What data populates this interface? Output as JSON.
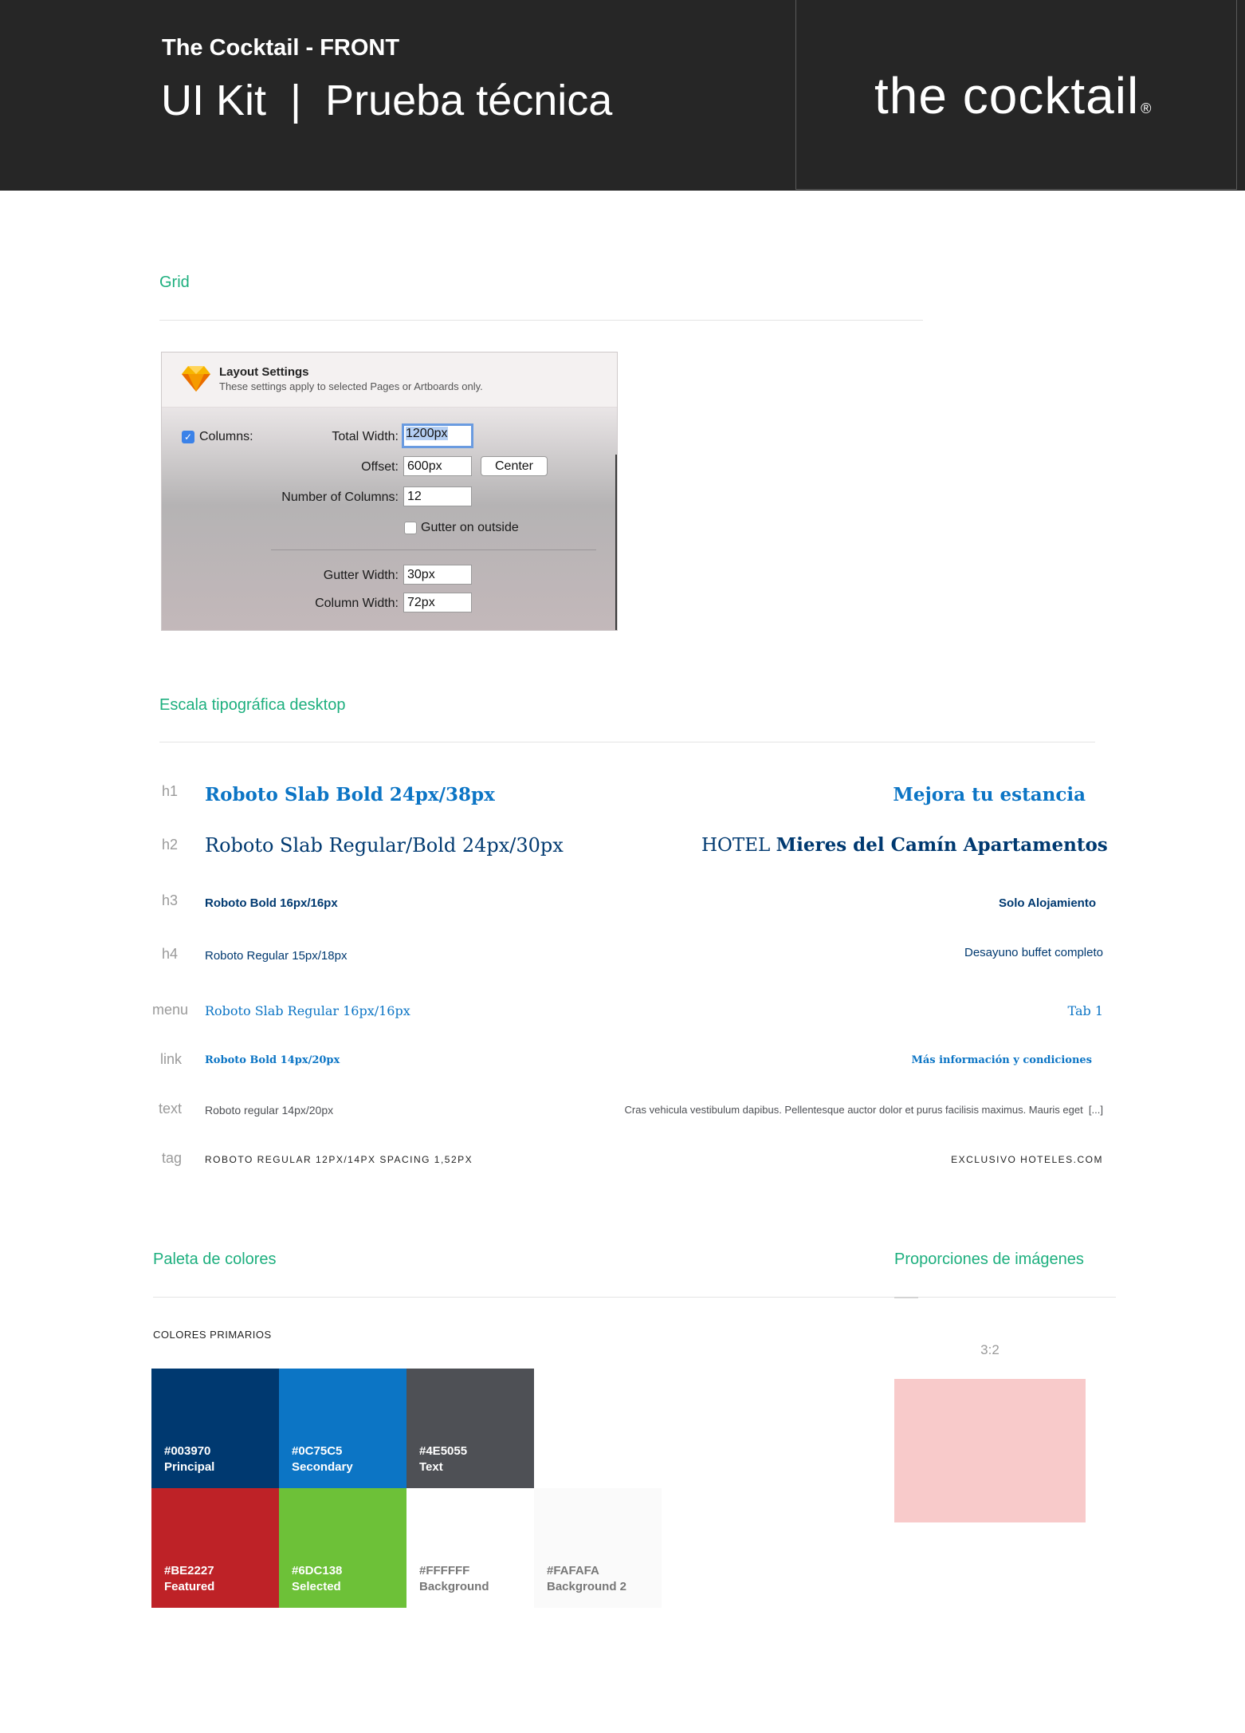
{
  "header": {
    "subtitle": "The Cocktail - FRONT",
    "title": "UI Kit  |  Prueba técnica",
    "logo_text": "the cocktail",
    "logo_mark": "®"
  },
  "grid": {
    "section_title": "Grid",
    "panel": {
      "icon": "sketch-diamond-icon",
      "title": "Layout Settings",
      "subtitle": "These settings apply to selected Pages or Artboards only.",
      "columns_label": "Columns:",
      "columns_checked": true,
      "total_width_label": "Total Width:",
      "total_width_value": "1200px",
      "offset_label": "Offset:",
      "offset_value": "600px",
      "center_button": "Center",
      "number_of_columns_label": "Number of Columns:",
      "number_of_columns_value": "12",
      "gutter_outside_label": "Gutter on outside",
      "gutter_outside_checked": false,
      "gutter_width_label": "Gutter Width:",
      "gutter_width_value": "30px",
      "column_width_label": "Column Width:",
      "column_width_value": "72px"
    }
  },
  "typography": {
    "section_title": "Escala tipográfica desktop",
    "rows": [
      {
        "tag": "h1",
        "spec": "Roboto Slab Bold 24px/38px",
        "sample": "Mejora tu estancia"
      },
      {
        "tag": "h2",
        "spec": "Roboto Slab Regular/Bold 24px/30px",
        "sample_regular": "HOTEL ",
        "sample_bold": "Mieres del Camín Apartamentos"
      },
      {
        "tag": "h3",
        "spec": "Roboto Bold 16px/16px",
        "sample": "Solo Alojamiento"
      },
      {
        "tag": "h4",
        "spec": "Roboto Regular 15px/18px",
        "sample": "Desayuno buffet completo"
      },
      {
        "tag": "menu",
        "spec": "Roboto Slab Regular 16px/16px",
        "sample": "Tab 1"
      },
      {
        "tag": "link",
        "spec": "Roboto Bold 14px/20px",
        "sample": "Más información y condiciones"
      },
      {
        "tag": "text",
        "spec": "Roboto regular 14px/20px",
        "sample": "Cras vehicula vestibulum dapibus. Pellentesque auctor dolor et purus facilisis maximus. Mauris eget  [...]"
      },
      {
        "tag": "tag",
        "spec": "ROBOTO REGULAR 12PX/14PX SPACING 1,52PX",
        "sample": "EXCLUSIVO HOTELES.COM"
      }
    ]
  },
  "palette": {
    "section_title": "Paleta de colores",
    "subtitle": "COLORES PRIMARIOS",
    "colors": [
      {
        "hex": "#003970",
        "name": "Principal"
      },
      {
        "hex": "#0C75C5",
        "name": "Secondary"
      },
      {
        "hex": "#4E5055",
        "name": "Text"
      },
      {
        "hex": "#BE2227",
        "name": "Featured"
      },
      {
        "hex": "#6DC138",
        "name": "Selected"
      },
      {
        "hex": "#FFFFFF",
        "name": "Background"
      },
      {
        "hex": "#FAFAFA",
        "name": "Background 2"
      }
    ]
  },
  "images": {
    "section_title": "Proporciones de imágenes",
    "ratio_label": "3:2",
    "placeholder_color": "#F8CACA"
  },
  "colors": {
    "accent_green": "#1DAF7E",
    "header_bg": "#262626"
  }
}
